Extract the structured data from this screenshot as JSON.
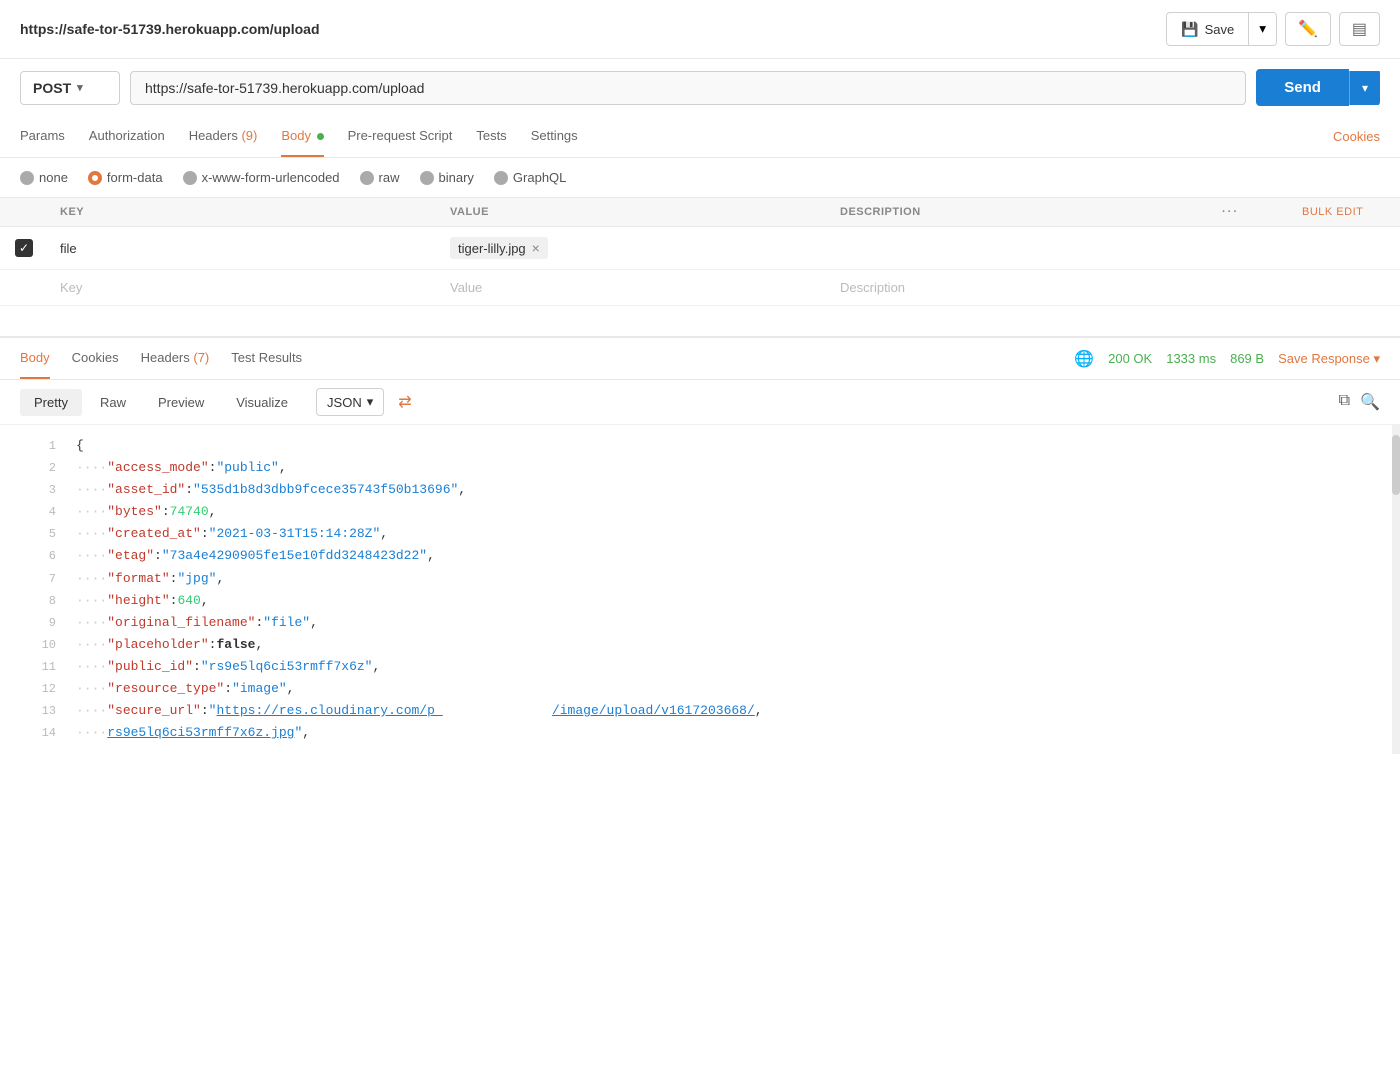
{
  "url_bar": {
    "url": "https://safe-tor-51739.herokuapp.com/upload",
    "url_display": "https://safe-tor-51739.herokuapp.com/upload",
    "save_label": "Save",
    "edit_icon": "✏",
    "comment_icon": "▤"
  },
  "request": {
    "method": "POST",
    "url_value": "https://safe-tor-51739.herokuapp.com/upload",
    "url_placeholder": "https://safe-tor-51739.herokuapp.com/upload",
    "send_label": "Send"
  },
  "tabs": {
    "items": [
      {
        "label": "Params",
        "active": false
      },
      {
        "label": "Authorization",
        "active": false
      },
      {
        "label": "Headers",
        "active": false,
        "count": "9",
        "count_colored": true
      },
      {
        "label": "Body",
        "active": true,
        "dot": true
      },
      {
        "label": "Pre-request Script",
        "active": false
      },
      {
        "label": "Tests",
        "active": false
      },
      {
        "label": "Settings",
        "active": false
      }
    ],
    "cookies_label": "Cookies"
  },
  "body_types": [
    {
      "label": "none",
      "selected": false
    },
    {
      "label": "form-data",
      "selected": true
    },
    {
      "label": "x-www-form-urlencoded",
      "selected": false
    },
    {
      "label": "raw",
      "selected": false
    },
    {
      "label": "binary",
      "selected": false
    },
    {
      "label": "GraphQL",
      "selected": false
    }
  ],
  "table": {
    "headers": {
      "key": "KEY",
      "value": "VALUE",
      "description": "DESCRIPTION",
      "bulk_edit": "Bulk Edit"
    },
    "rows": [
      {
        "checked": true,
        "key": "file",
        "value": "tiger-lilly.jpg",
        "description": ""
      }
    ],
    "empty_row": {
      "key_placeholder": "Key",
      "value_placeholder": "Value",
      "desc_placeholder": "Description"
    }
  },
  "response": {
    "tabs": [
      {
        "label": "Body",
        "active": true
      },
      {
        "label": "Cookies",
        "active": false
      },
      {
        "label": "Headers",
        "active": false,
        "count": "7"
      },
      {
        "label": "Test Results",
        "active": false
      }
    ],
    "status": "200 OK",
    "time": "1333 ms",
    "size": "869 B",
    "save_response": "Save Response",
    "format_tabs": [
      {
        "label": "Pretty",
        "active": true
      },
      {
        "label": "Raw",
        "active": false
      },
      {
        "label": "Preview",
        "active": false
      },
      {
        "label": "Visualize",
        "active": false
      }
    ],
    "format_select": "JSON",
    "json_lines": [
      {
        "num": 1,
        "content": "{",
        "type": "bracket"
      },
      {
        "num": 2,
        "key": "access_mode",
        "value": "\"public\"",
        "value_type": "str"
      },
      {
        "num": 3,
        "key": "asset_id",
        "value": "\"535d1b8d3dbb9fcece35743f50b13696\"",
        "value_type": "str"
      },
      {
        "num": 4,
        "key": "bytes",
        "value": "74740",
        "value_type": "num"
      },
      {
        "num": 5,
        "key": "created_at",
        "value": "\"2021-03-31T15:14:28Z\"",
        "value_type": "str"
      },
      {
        "num": 6,
        "key": "etag",
        "value": "\"73a4e4290905fe15e10fdd3248423d22\"",
        "value_type": "str"
      },
      {
        "num": 7,
        "key": "format",
        "value": "\"jpg\"",
        "value_type": "str"
      },
      {
        "num": 8,
        "key": "height",
        "value": "640",
        "value_type": "num"
      },
      {
        "num": 9,
        "key": "original_filename",
        "value": "\"file\"",
        "value_type": "str"
      },
      {
        "num": 10,
        "key": "placeholder",
        "value": "false",
        "value_type": "bool"
      },
      {
        "num": 11,
        "key": "public_id",
        "value": "\"rs9e5lq6ci53rmff7x6z\"",
        "value_type": "str"
      },
      {
        "num": 12,
        "key": "resource_type",
        "value": "\"image\"",
        "value_type": "str"
      },
      {
        "num": 13,
        "key": "secure_url",
        "value_part1": "\"https://res.cloudinary.com/p_",
        "value_link": "/image/upload/v1617203668/",
        "value_part2": "",
        "value_type": "link_str"
      },
      {
        "num": 14,
        "key_empty": true,
        "value": "rs9e5lq6ci53rmff7x6z.jpg\"",
        "value_type": "link_continue"
      }
    ]
  }
}
